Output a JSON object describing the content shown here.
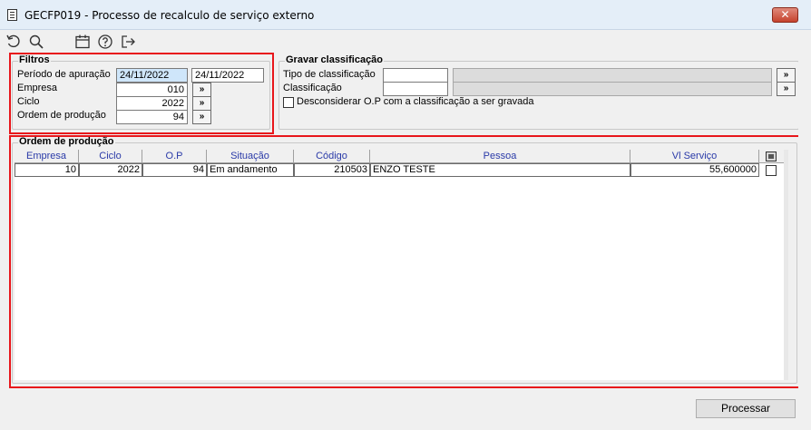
{
  "window": {
    "title": "GECFP019 - Processo de recalculo de serviço externo",
    "close_label": "✕"
  },
  "toolbar": {
    "icons": [
      "undo-icon",
      "search-icon",
      "calendar-icon",
      "help-icon",
      "exit-icon"
    ]
  },
  "filtros": {
    "title": "Filtros",
    "periodo_label": "Período de apuração",
    "periodo_inicio": "24/11/2022",
    "periodo_fim": "24/11/2022",
    "empresa_label": "Empresa",
    "empresa_value": "010",
    "ciclo_label": "Ciclo",
    "ciclo_value": "2022",
    "ordem_label": "Ordem de produção",
    "ordem_value": "94",
    "lookup_label": "»"
  },
  "gravar": {
    "title": "Gravar classificação",
    "tipo_label": "Tipo de classificação",
    "tipo_value": "",
    "tipo_desc": "",
    "classificacao_label": "Classificação",
    "classificacao_value": "",
    "classificacao_desc": "",
    "lookup_label": "»",
    "desconsiderar_label": "Desconsiderar O.P com a classificação a ser gravada",
    "desconsiderar_checked": false
  },
  "ordem": {
    "title": "Ordem de produção",
    "columns": [
      "Empresa",
      "Ciclo",
      "O.P",
      "Situação",
      "Código",
      "Pessoa",
      "Vl Serviço"
    ],
    "rows": [
      {
        "empresa": "10",
        "ciclo": "2022",
        "op": "94",
        "situacao": "Em andamento",
        "codigo": "210503",
        "pessoa": "ENZO TESTE",
        "vl_servico": "55,600000",
        "checked": false
      }
    ]
  },
  "footer": {
    "processar_label": "Processar"
  },
  "colors": {
    "highlight_border": "#e8161b",
    "header_text": "#2a3aa8",
    "selected_field": "#cfe6fa"
  }
}
